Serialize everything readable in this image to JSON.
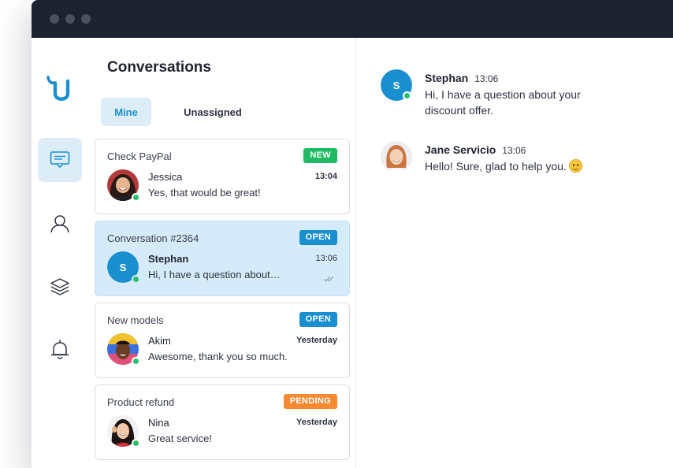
{
  "sidebar": {
    "logo": "u-logo",
    "items": [
      {
        "name": "chat-icon",
        "active": true
      },
      {
        "name": "contacts-icon",
        "active": false
      },
      {
        "name": "layers-icon",
        "active": false
      },
      {
        "name": "bell-icon",
        "active": false
      }
    ]
  },
  "list": {
    "title": "Conversations",
    "tabs": [
      {
        "label": "Mine",
        "active": true
      },
      {
        "label": "Unassigned",
        "active": false
      }
    ],
    "conversations": [
      {
        "subject": "Check PayPal",
        "badge": "NEW",
        "name": "Jessica",
        "time": "13:04",
        "preview": "Yes, that would be great!",
        "online": true
      },
      {
        "subject": "Conversation #2364",
        "badge": "OPEN",
        "name": "Stephan",
        "time": "13:06",
        "preview": "Hi, I have a question about…",
        "online": true,
        "selected": true,
        "avatar_initial": "S",
        "read_receipt": "double-check-icon"
      },
      {
        "subject": "New models",
        "badge": "OPEN",
        "name": "Akim",
        "time": "Yesterday",
        "preview": "Awesome, thank you so much.",
        "online": true
      },
      {
        "subject": "Product refund",
        "badge": "PENDING",
        "name": "Nina",
        "time": "Yesterday",
        "preview": "Great service!",
        "online": true
      }
    ]
  },
  "chat": {
    "messages": [
      {
        "author": "Stephan",
        "time": "13:06",
        "text": "Hi, I have a question about your discount offer.",
        "avatar_initial": "S",
        "online": true
      },
      {
        "author": "Jane Servicio",
        "time": "13:06",
        "text": "Hello! Sure, glad to help you.",
        "emoji": "slightly-smiling-face"
      }
    ]
  },
  "colors": {
    "accent": "#1a8fd0",
    "titlebar": "#1c2230",
    "badge_new": "#1fba63",
    "badge_open": "#1a8fd0",
    "badge_pending": "#f58a32",
    "presence": "#26c06b",
    "selected_bg": "#d6ebf9"
  }
}
